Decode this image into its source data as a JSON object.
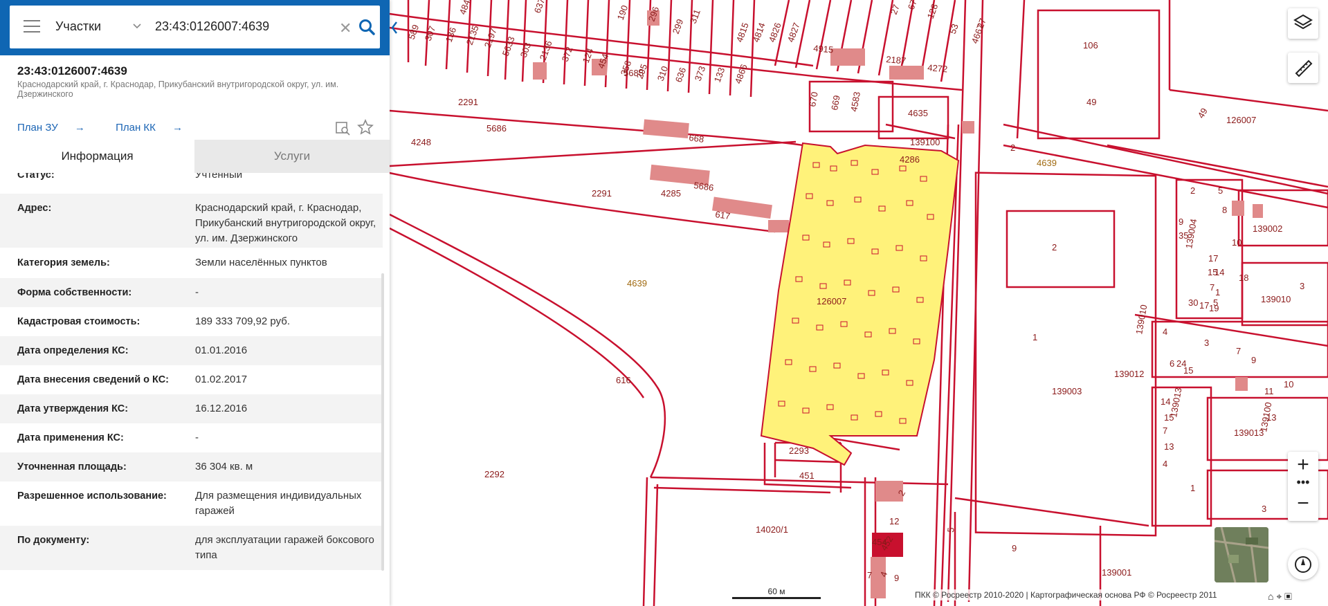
{
  "search": {
    "category": "Участки",
    "query": "23:43:0126007:4639"
  },
  "object": {
    "title": "23:43:0126007:4639",
    "address_short": "Краснодарский край, г. Краснодар, Прикубанский внутригородской округ, ул. им. Дзержинского",
    "link_plan_zu": "План ЗУ",
    "link_plan_kk": "План КК"
  },
  "tabs": {
    "info": "Информация",
    "services": "Услуги"
  },
  "info_rows": [
    {
      "key": "Статус:",
      "value": "Учтенный"
    },
    {
      "key": "Адрес:",
      "value": "Краснодарский край, г. Краснодар, Прикубанский внутригородской округ, ул. им. Дзержинского"
    },
    {
      "key": "Категория земель:",
      "value": "Земли населённых пунктов"
    },
    {
      "key": "Форма собственности:",
      "value": "-"
    },
    {
      "key": "Кадастровая стоимость:",
      "value": "189 333 709,92 руб."
    },
    {
      "key": "Дата определения КС:",
      "value": "01.01.2016"
    },
    {
      "key": "Дата внесения сведений о КС:",
      "value": "01.02.2017"
    },
    {
      "key": "Дата утверждения КС:",
      "value": "16.12.2016"
    },
    {
      "key": "Дата применения КС:",
      "value": "-"
    },
    {
      "key": "Уточненная площадь:",
      "value": "36 304 кв. м"
    },
    {
      "key": "Разрешенное использование:",
      "value": "Для размещения индивидуальных гаражей"
    },
    {
      "key": "По документу:",
      "value": "для эксплуатации гаражей боксового типа"
    }
  ],
  "map": {
    "labels": [
      "589",
      "307",
      "136",
      "2135",
      "2197",
      "5633",
      "303",
      "2136",
      "372",
      "124",
      "454",
      "358",
      "295",
      "310",
      "636",
      "373",
      "133",
      "4866",
      "4842",
      "637",
      "190",
      "296",
      "299",
      "311",
      "4815",
      "4814",
      "4826",
      "4827",
      "4915",
      "2187",
      "4272",
      "27",
      "67",
      "128",
      "53",
      "4667",
      "27",
      "106",
      "49",
      "49",
      "126007",
      "5685",
      "2291",
      "5686",
      "4248",
      "668",
      "670",
      "669",
      "4583",
      "4635",
      "139100",
      "2",
      "4639",
      "4286",
      "5686",
      "2291",
      "4285",
      "617",
      "4639",
      "126007",
      "616",
      "2292",
      "2293",
      "451",
      "2",
      "12",
      "454",
      "452",
      "4",
      "7",
      "9",
      "14020/1",
      "5",
      "9",
      "139001",
      "1",
      "2",
      "139003",
      "139002",
      "139004",
      "139010",
      "139010",
      "139012",
      "139100",
      "139013",
      "139013",
      "3",
      "1",
      "2",
      "5",
      "8",
      "9",
      "10",
      "35",
      "17",
      "15",
      "14",
      "7",
      "1",
      "5",
      "30",
      "19",
      "17",
      "18",
      "3",
      "4",
      "6",
      "24",
      "15",
      "3",
      "7",
      "9",
      "10",
      "11",
      "13",
      "14",
      "15",
      "7",
      "13",
      "4"
    ],
    "highlighted_parcel": "4639",
    "parcel_color": "#fff27a",
    "line_color": "#c8102e",
    "building_color": "#e08a8a",
    "scale_label": "60 м",
    "copyright": "ПКК © Росреестр 2010-2020 | Картографическая основа РФ © Росреестр 2011"
  }
}
